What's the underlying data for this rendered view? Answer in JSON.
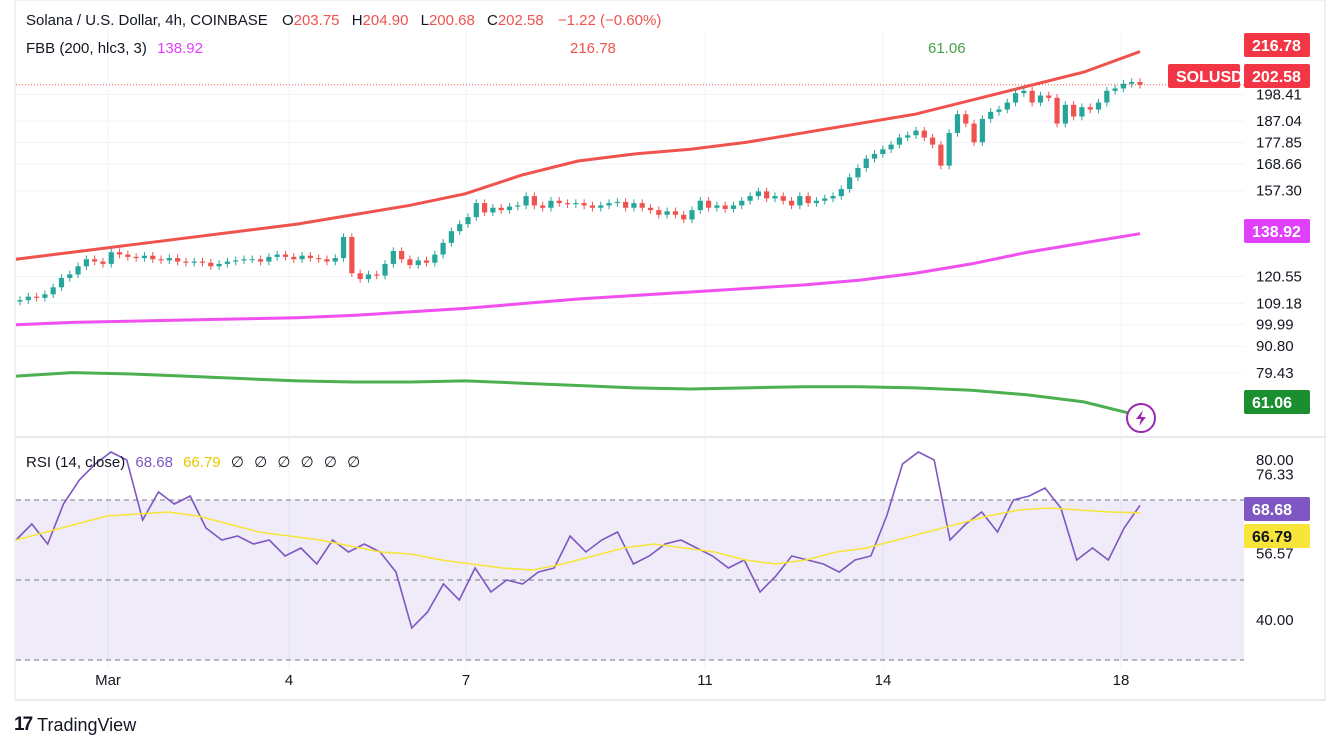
{
  "header": {
    "symbol": "Solana / U.S. Dollar, 4h, COINBASE",
    "o_label": "O",
    "o_value": "203.75",
    "h_label": "H",
    "h_value": "204.90",
    "l_label": "L",
    "l_value": "200.68",
    "c_label": "C",
    "c_value": "202.58",
    "change": "−1.22 (−0.60%)"
  },
  "fbb_legend": {
    "name": "FBB (200, hlc3, 3)",
    "basis": "138.92",
    "upper": "216.78",
    "lower": "61.06"
  },
  "rsi_legend": {
    "name": "RSI (14, close)",
    "rsi": "68.68",
    "ma": "66.79",
    "empty_values": [
      "∅",
      "∅",
      "∅",
      "∅",
      "∅",
      "∅"
    ]
  },
  "price_badges": {
    "upper": "216.78",
    "symbol": "SOLUSD",
    "last": "202.58",
    "basis": "138.92",
    "lower": "61.06"
  },
  "rsi_badges": {
    "rsi": "68.68",
    "ma": "66.79"
  },
  "brand": {
    "name": "TradingView"
  },
  "colors": {
    "up": "#26a69a",
    "down": "#ef5350",
    "upper_band": "#f0524d",
    "basis": "#f050f0",
    "lower_band": "#4caf50",
    "rsi": "#7e57c2",
    "rsi_ma": "#f7e53a"
  },
  "chart_data": [
    {
      "type": "candlestick",
      "title": "Solana / U.S. Dollar, 4h, COINBASE",
      "y_ticks": [
        "198.41",
        "187.04",
        "177.85",
        "168.66",
        "157.30",
        "120.55",
        "109.18",
        "99.99",
        "90.80",
        "79.43"
      ],
      "x_ticks": [
        "Mar",
        "4",
        "7",
        "11",
        "14",
        "18"
      ],
      "ylim": [
        52,
        226
      ],
      "closes": [
        110.5,
        112,
        111.5,
        113,
        116,
        120,
        121.5,
        125,
        128,
        127,
        126,
        131,
        130,
        129,
        128.5,
        129.5,
        128,
        127.5,
        128.5,
        127,
        126.5,
        127,
        126.5,
        125,
        126,
        127,
        127.5,
        128,
        128,
        127,
        129,
        130,
        129,
        128,
        129.5,
        128.5,
        128,
        127,
        128.5,
        137.5,
        122,
        119.5,
        121.5,
        121,
        126,
        131.5,
        128,
        125.5,
        127.5,
        126.5,
        130,
        135,
        140,
        143,
        146,
        152,
        148,
        150,
        149,
        150.5,
        151,
        155,
        151,
        150,
        153,
        152,
        151.5,
        152,
        151,
        150,
        151,
        152,
        152.5,
        150,
        152,
        150,
        149,
        147,
        148.5,
        147,
        145,
        149,
        153,
        150,
        151,
        149.5,
        151,
        153,
        155,
        157,
        154,
        155,
        153,
        151,
        155,
        152,
        153,
        154,
        155,
        158,
        163,
        167,
        171,
        173,
        175,
        177,
        180,
        181,
        183,
        180,
        177,
        168,
        182,
        190,
        186,
        178,
        188,
        191,
        192,
        195,
        199,
        200,
        195,
        198,
        197,
        186,
        194,
        189,
        193,
        192,
        195,
        200,
        201,
        203,
        203.75,
        202.58
      ],
      "series": [
        {
          "name": "216.78",
          "values": [
            128,
            131,
            134,
            137,
            140,
            143,
            147,
            151,
            156,
            164,
            170,
            173,
            175,
            178,
            182,
            186,
            190,
            196,
            202,
            208,
            216.78
          ]
        },
        {
          "name": "138.92",
          "values": [
            100,
            101,
            101.5,
            102,
            102.5,
            103,
            104,
            105.5,
            107,
            109,
            111,
            112.5,
            114,
            115.5,
            117,
            119,
            122,
            126,
            131,
            135,
            138.92
          ]
        },
        {
          "name": "61.06",
          "values": [
            78,
            79.5,
            79,
            78,
            77,
            76,
            75.5,
            75.5,
            76,
            75,
            74,
            73,
            72.5,
            73,
            73.5,
            73.5,
            73,
            72,
            70,
            67,
            61.06
          ]
        }
      ]
    },
    {
      "type": "line",
      "title": "RSI (14, close)",
      "y_ticks": [
        "80.00",
        "76.33",
        "56.57",
        "40.00"
      ],
      "ylim": [
        28,
        85
      ],
      "series": [
        {
          "name": "68.68",
          "values": [
            60,
            64,
            59,
            69,
            75,
            79,
            82,
            80,
            65,
            72,
            69,
            71,
            63,
            60,
            61,
            59,
            60,
            56,
            58,
            54,
            60,
            57,
            59,
            57,
            52,
            38,
            42,
            49,
            45,
            53,
            47,
            50,
            49,
            52,
            53,
            61,
            57,
            60,
            62,
            54,
            56,
            59,
            60,
            58,
            56,
            53,
            55,
            47,
            51,
            56,
            55,
            54,
            52,
            55,
            56,
            66,
            79,
            82,
            80,
            60,
            64,
            67,
            62,
            70,
            71,
            73,
            68,
            55,
            58,
            55,
            63,
            68.68
          ]
        },
        {
          "name": "66.79",
          "values": [
            60,
            62,
            64,
            66,
            66.5,
            67,
            66,
            64,
            62,
            61,
            60,
            58.5,
            57,
            56.5,
            55,
            54,
            53,
            52.5,
            54,
            56,
            58,
            59,
            58,
            57,
            55,
            54,
            55,
            57,
            58,
            60,
            62,
            64,
            66,
            67.5,
            68,
            67.5,
            67,
            66.79
          ]
        }
      ]
    }
  ]
}
